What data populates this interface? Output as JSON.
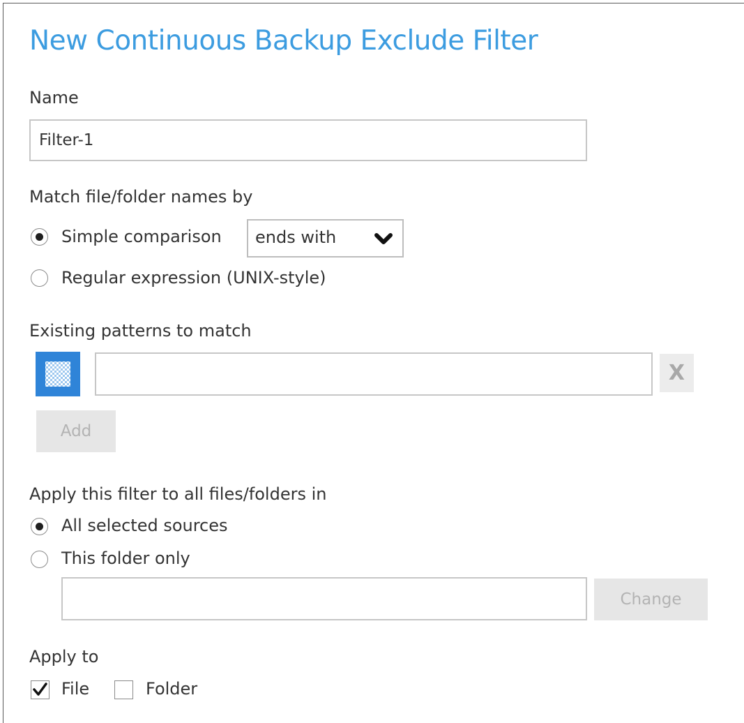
{
  "dialog": {
    "title": "New Continuous Backup Exclude Filter"
  },
  "name_section": {
    "label": "Name",
    "value": "Filter-1"
  },
  "match_section": {
    "label": "Match file/folder names by",
    "simple_label": "Simple comparison",
    "simple_selected": true,
    "comparison_value": "ends with",
    "regex_label": "Regular expression (UNIX-style)",
    "regex_selected": false
  },
  "patterns_section": {
    "label": "Existing patterns to match",
    "pattern_value": "",
    "remove_label": "X",
    "add_label": "Add",
    "pattern_icon": "checkerboard-pattern-icon"
  },
  "apply_filter_section": {
    "label": "Apply this filter to all files/folders in",
    "all_sources_label": "All selected sources",
    "all_sources_selected": true,
    "folder_only_label": "This folder only",
    "folder_only_selected": false,
    "folder_path": "",
    "change_label": "Change"
  },
  "apply_to_section": {
    "label": "Apply to",
    "file_label": "File",
    "file_checked": true,
    "folder_label": "Folder",
    "folder_checked": false
  },
  "colors": {
    "title": "#3c9ce0",
    "icon_bg": "#2f84d8",
    "disabled_button_bg": "#e6e6e6",
    "disabled_text": "#b3b3b3"
  }
}
